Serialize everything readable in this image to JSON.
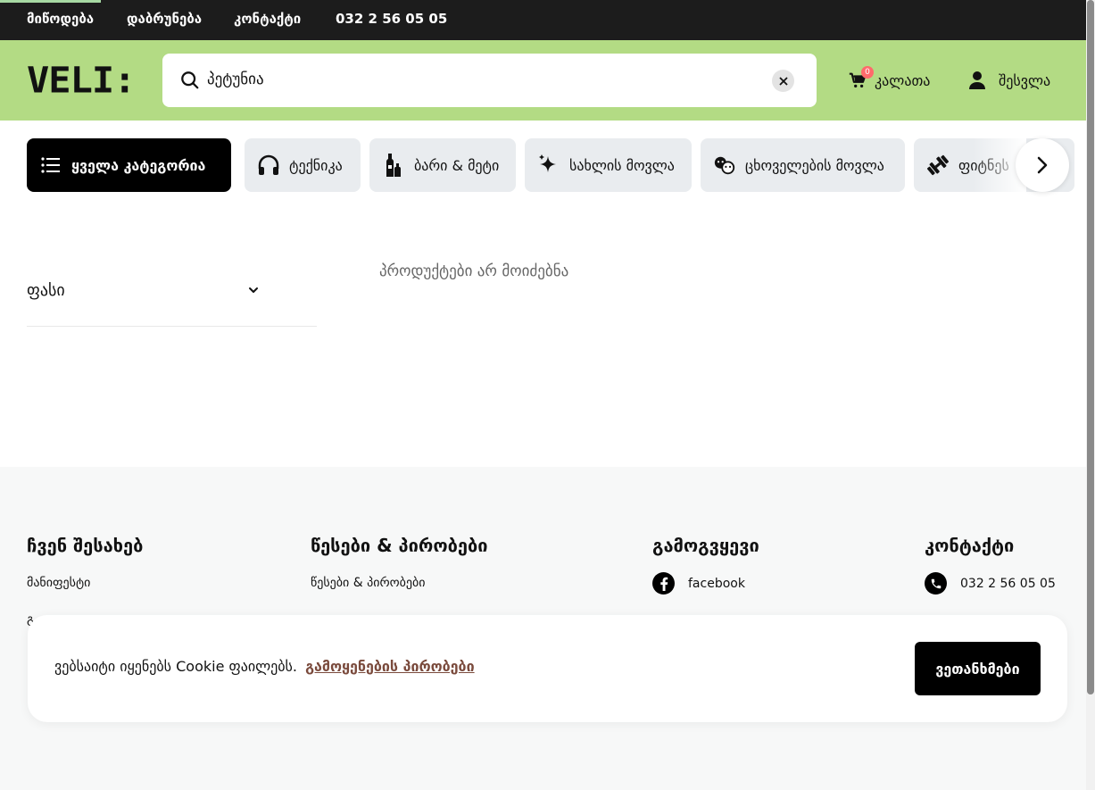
{
  "topbar": {
    "links": [
      "მიწოდება",
      "დაბრუნება",
      "კონტაქტი"
    ],
    "phone": "032 2 56 05 05"
  },
  "header": {
    "logo": "VELI:",
    "search_value": "პეტუნია",
    "cart_count": "0",
    "cart_label": "კალათა",
    "login_label": "შესვლა"
  },
  "categories": {
    "all_label": "ყველა კატეგორია",
    "items": [
      {
        "label": "ტექნიკა",
        "icon": "headphones-icon"
      },
      {
        "label": "ბარი & მეტი",
        "icon": "bottles-icon"
      },
      {
        "label": "სახლის მოვლა",
        "icon": "sparkle-icon"
      },
      {
        "label": "ცხოველების მოვლა",
        "icon": "pets-icon"
      },
      {
        "label": "ფიტნეს",
        "icon": "dumbbell-icon"
      }
    ]
  },
  "filters": {
    "price_label": "ფასი"
  },
  "results": {
    "empty_message": "პროდუქტები არ მოიძებნა"
  },
  "footer": {
    "about": {
      "title": "ჩვენ შესახებ",
      "links": [
        "მანიფესტი"
      ],
      "cut_text": "გ"
    },
    "terms": {
      "title": "წესები & პირობები",
      "links": [
        "წესები & პირობები"
      ]
    },
    "follow": {
      "title": "გამოგვყევი",
      "facebook": "facebook"
    },
    "contact": {
      "title": "კონტაქტი",
      "phone": "032 2 56 05 05"
    }
  },
  "cookie": {
    "message": "ვებსაიტი იყენებს Cookie ფაილებს.",
    "terms_link": "გამოყენების პირობები",
    "agree_button": "ვეთანხმები"
  },
  "colors": {
    "header_green": "#b3db84",
    "topbar_dark": "#1c1c1c",
    "badge_red": "#ff6b6b",
    "terms_link": "#7a4a3c"
  }
}
